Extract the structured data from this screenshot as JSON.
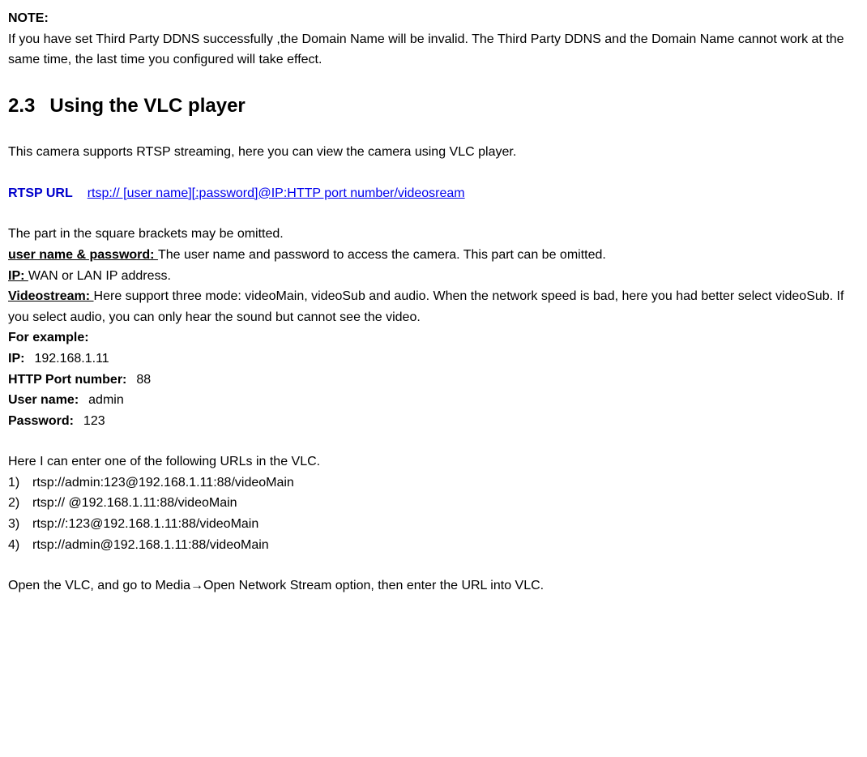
{
  "note": {
    "label": "NOTE:",
    "text": "If you have set Third Party DDNS successfully ,the Domain Name will be invalid. The Third Party DDNS and the Domain Name cannot work at the same time, the last time you configured will take effect."
  },
  "section": {
    "number": "2.3",
    "title": "Using the VLC player"
  },
  "intro": "This camera supports RTSP streaming, here you can view the camera using VLC player.",
  "rtsp": {
    "label": "RTSP URL",
    "link": "rtsp:// [user name][:password]@IP:HTTP port number/videosream"
  },
  "brackets_note": "The part in the square brackets may be omitted.",
  "defs": {
    "user_label": "user name & password: ",
    "user_text": "The user name and password to access the camera. This part can be omitted.",
    "ip_label": "IP: ",
    "ip_text": "WAN or LAN IP address.",
    "video_label": "Videostream: ",
    "video_text": "Here support three mode: videoMain, videoSub and audio. When the network speed is bad, here you had better select videoSub. If you select audio, you can only hear the sound but cannot see the video."
  },
  "example": {
    "heading": "For example:",
    "ip_label": "IP:",
    "ip_val": "192.168.1.11",
    "port_label": "HTTP Port number:",
    "port_val": "88",
    "user_label": "User name:",
    "user_val": "admin",
    "pass_label": "Password:",
    "pass_val": "123"
  },
  "urls_intro": "Here I can enter one of the following URLs in the VLC.",
  "urls": [
    "rtsp://admin:123@192.168.1.11:88/videoMain",
    "rtsp:// @192.168.1.11:88/videoMain",
    "rtsp://:123@192.168.1.11:88/videoMain",
    "rtsp://admin@192.168.1.11:88/videoMain"
  ],
  "url_nums": [
    "1)",
    "2)",
    "3)",
    "4)"
  ],
  "open_vlc": "Open the VLC, and go to Media→Open Network Stream option, then enter the URL into VLC."
}
